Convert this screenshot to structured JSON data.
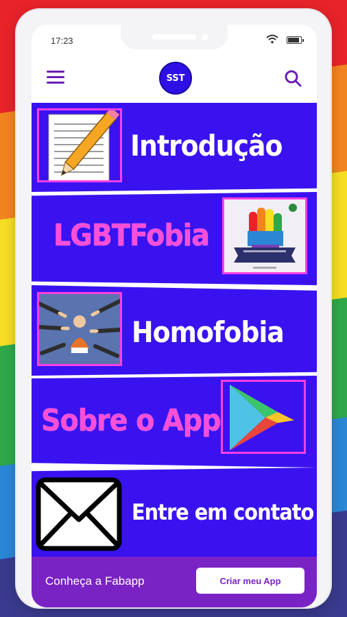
{
  "status_bar": {
    "time": "17:23"
  },
  "app_bar": {
    "logo_text": "SST"
  },
  "menu": [
    {
      "label": "Introdução",
      "icon": "notepad-pencil-icon"
    },
    {
      "label": "LGBTFobia",
      "icon": "pride-fist-icon"
    },
    {
      "label": "Homofobia",
      "icon": "pointing-hands-icon"
    },
    {
      "label": "Sobre o App",
      "icon": "play-store-icon"
    },
    {
      "label": "Entre em contato",
      "icon": "envelope-icon"
    }
  ],
  "footer": {
    "text": "Conheça a Fabapp",
    "button_label": "Criar meu App"
  },
  "colors": {
    "banner": "#3a12f0",
    "accent_pink": "#ff4fd8",
    "footer": "#7a23c4",
    "menu_icon": "#6a1db5"
  }
}
